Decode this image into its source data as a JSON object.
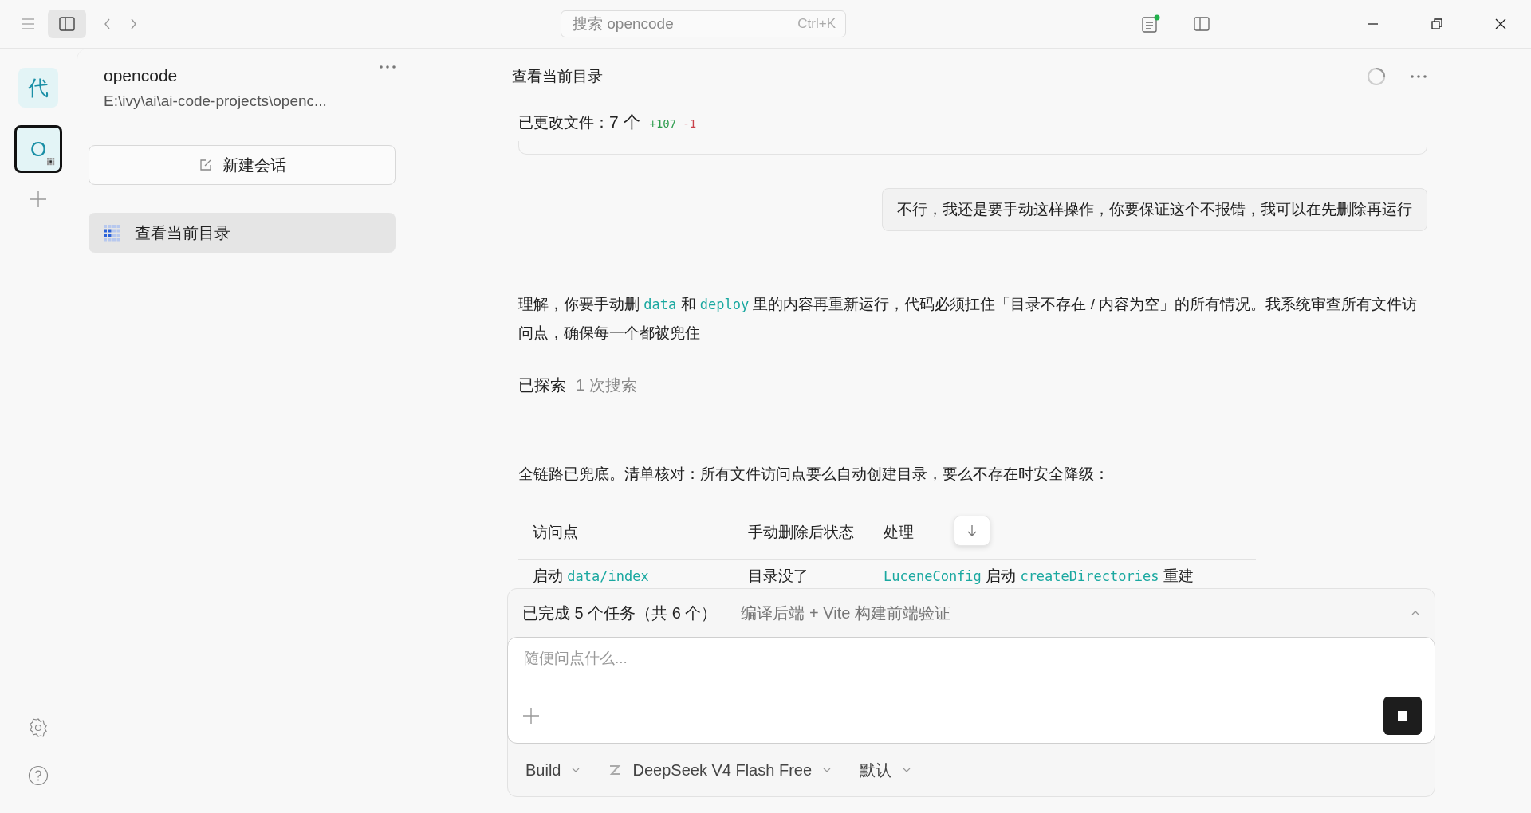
{
  "topbar": {
    "search": {
      "placeholder": "搜索 opencode",
      "shortcut": "Ctrl+K"
    },
    "notification": true
  },
  "rail": {
    "projects": [
      {
        "label": "代",
        "selected": false,
        "busy": false
      },
      {
        "label": "O",
        "selected": true,
        "busy": true
      }
    ]
  },
  "project": {
    "name": "opencode",
    "path": "E:\\ivy\\ai\\ai-code-projects\\openc...",
    "new_session": "新建会话",
    "sessions": [
      {
        "title": "查看当前目录",
        "selected": true,
        "busy": true
      }
    ]
  },
  "session": {
    "title": "查看当前目录",
    "loading": true
  },
  "messages": [
    {
      "kind": "changes",
      "label": "已更改文件：",
      "count": "7 个",
      "added": "+107",
      "removed": "-1"
    },
    {
      "kind": "user",
      "text": "不行，我还是要手动这样操作，你要保证这个不报错，我可以在先删除再运行"
    },
    {
      "kind": "paragraph",
      "segments": [
        {
          "text": "理解，你要手动删 "
        },
        {
          "text": "data",
          "code": true
        },
        {
          "text": " 和 "
        },
        {
          "text": "deploy",
          "code": true
        },
        {
          "text": " 里的内容再重新运行，代码必须扛住「目录不存在 / 内容为空」的所有情况。我系统审查所有文件访问点，确保每一个都被兜住"
        }
      ]
    },
    {
      "kind": "explored",
      "label": "已探索",
      "detail": "1 次搜索"
    },
    {
      "kind": "paragraph",
      "segments": [
        {
          "text": "全链路已兜底。清单核对：所有文件访问点要么自动创建目录，要么不存在时安全降级："
        }
      ]
    },
    {
      "kind": "table",
      "columns": [
        "访问点",
        "手动删除后状态",
        "处理"
      ],
      "rows": [
        [
          [
            {
              "text": "启动 "
            },
            {
              "text": "data/index",
              "code": true
            }
          ],
          [
            {
              "text": "目录没了"
            }
          ],
          [
            {
              "text": "LuceneConfig",
              "code": true
            },
            {
              "text": " 启动 "
            },
            {
              "text": "createDirectories",
              "code": true
            },
            {
              "text": " 重建"
            }
          ]
        ]
      ]
    }
  ],
  "tasks": {
    "summary": "已完成 5 个任务（共 6 个）",
    "current": "编译后端 + Vite 构建前端验证"
  },
  "composer": {
    "placeholder": "随便问点什么...",
    "agent": "Build",
    "model": "DeepSeek V4 Flash Free",
    "variant": "默认"
  }
}
